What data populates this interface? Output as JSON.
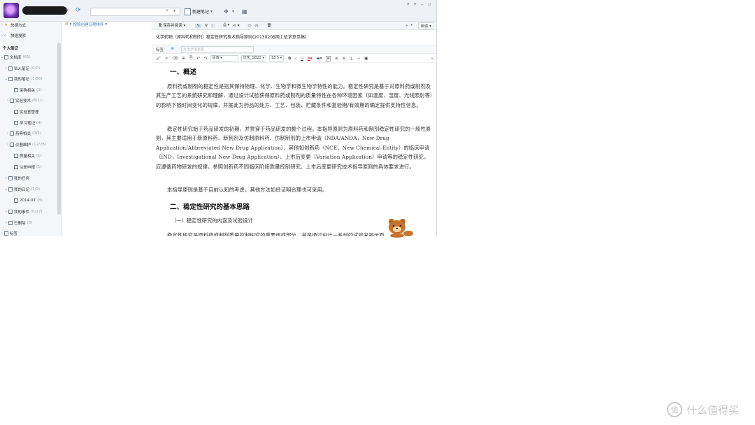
{
  "toolbar": {
    "new_note_label": "新建笔记",
    "sync_icon": "sync-icon",
    "window_controls": [
      "▾",
      "▾",
      "–",
      "▫"
    ]
  },
  "sidebar": {
    "quick_shortcuts": "快捷方式",
    "quick_search": "快速搜索",
    "personal_notes": "个人笔记",
    "items": [
      {
        "label": "文档库",
        "count": "(65)"
      },
      {
        "label": "私人笔记",
        "count": "(0/0)"
      },
      {
        "label": "我的笔记",
        "count": "(5/56)"
      },
      {
        "label": "采购相关",
        "count": "(3)"
      },
      {
        "label": "实验技术",
        "count": "(8/11)"
      },
      {
        "label": "实验室管理",
        "count": ""
      },
      {
        "label": "学习笔记",
        "count": "(4)"
      },
      {
        "label": "药典相关",
        "count": "(0/1)"
      },
      {
        "label": "仪器维护",
        "count": "(12/26)"
      },
      {
        "label": "质量相关",
        "count": "(1)"
      },
      {
        "label": "注册申报",
        "count": "(1)"
      },
      {
        "label": "我的任务",
        "count": ""
      },
      {
        "label": "我的日记",
        "count": "(1/9)"
      },
      {
        "label": "2014-07",
        "count": "(8)"
      },
      {
        "label": "我的事件",
        "count": "(0/27)"
      },
      {
        "label": "已删除",
        "count": "(3)"
      },
      {
        "label": "标签",
        "count": ""
      }
    ]
  },
  "notelist": {
    "sort_label": "按照创建日期排序"
  },
  "editor": {
    "save_label": "保存并阅读",
    "read_label": "阅读",
    "title": "化学药物（原料药和制剂）稳定性研究技术指导原则(20130205网上征求意见稿)",
    "tag_label": "标签",
    "tag_placeholder": "点击添加标签",
    "format": {
      "style": "段落",
      "font": "仿宋_GB23",
      "size": "13.5"
    },
    "h1_1": "一、概述",
    "p1": "原料药或制剂的稳定性是指其保持物理、化学、生物学和微生物学特性的能力。稳定性研究是基于对原料药或制剂及其生产工艺的系统研究和理解，通过设计试验获得原料药或制剂的质量特性在各种环境因素（如温度、湿度、光线照射等）的影响下随时间变化的规律，并据此为药品的处方、工艺、包装、贮藏条件和复验期/有效期的确定提供支持性信息。",
    "p2": "稳定性研究始于药品研发的初期，并贯穿于药品研发的整个过程。本指导原则为原料药和制剂稳定性研究的一般性原则，其主要适用于新原料药、新制剂及仿制原料药、仿制制剂的上市申请（NDA/ANDA，New Drug Application/Abbreviated New Drug Application），其他如创新药（NCE，New Chemical Entity）的临床申请（IND，Investigational New Drug Application）、上市后变更（Variation Application）申请等的稳定性研究，应遵循药物研发的规律，参照创新药不同临床阶段质量控制研究、上市后变更研究技术指导原则的具体要求进行。",
    "p3": "本指导原则是基于目前认知的考虑，其他方法如经证明合理也可采用。",
    "h1_2": "二、稳定性研究的基本思路",
    "h2_1": "（一）稳定性研究的内容及试验设计",
    "p4": "稳定性研究是原料药或制剂质量控制研究的重要组成部分，其是通过设计一系列的试验来揭示原"
  },
  "watermark": {
    "text": "什么值得买"
  }
}
